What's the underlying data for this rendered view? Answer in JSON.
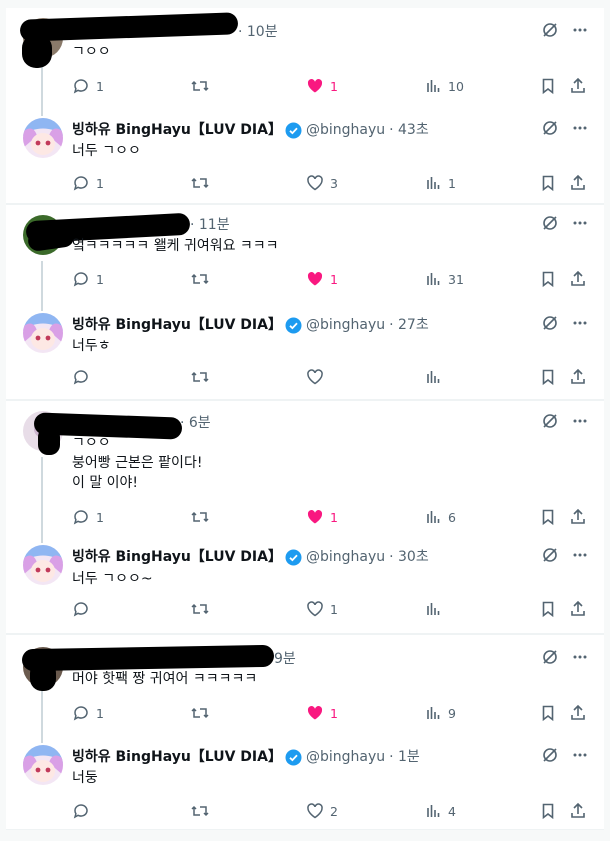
{
  "threads": [
    {
      "reply": {
        "time_label": "· 10분",
        "text": "ㄱㅇㅇ",
        "stats": {
          "replies": "1",
          "retweets": "",
          "likes": "1",
          "views": "10"
        },
        "liked": true
      },
      "answer": {
        "name": "빙하유 BingHayu【LUV DIA】",
        "handle": "@binghayu",
        "time_label": "· 43초",
        "text": "너두 ㄱㅇㅇ",
        "stats": {
          "replies": "1",
          "retweets": "",
          "likes": "3",
          "views": "1"
        },
        "liked": false
      }
    },
    {
      "reply": {
        "time_label": "· 11분",
        "text": "엌ㅋㅋㅋㅋㅋ 왤케 귀여워요 ㅋㅋㅋ",
        "stats": {
          "replies": "1",
          "retweets": "",
          "likes": "1",
          "views": "31"
        },
        "liked": true
      },
      "answer": {
        "name": "빙하유 BingHayu【LUV DIA】",
        "handle": "@binghayu",
        "time_label": "· 27초",
        "text": "너두ㅎ",
        "stats": {
          "replies": "",
          "retweets": "",
          "likes": "",
          "views": ""
        },
        "liked": false
      }
    },
    {
      "reply": {
        "time_label": "· 6분",
        "text": "ㄱㅇㅇ\n붕어빵 근본은 팥이다!\n이 말 이야!",
        "stats": {
          "replies": "1",
          "retweets": "",
          "likes": "1",
          "views": "6"
        },
        "liked": true
      },
      "answer": {
        "name": "빙하유 BingHayu【LUV DIA】",
        "handle": "@binghayu",
        "time_label": "· 30초",
        "text": "너두 ㄱㅇㅇ~",
        "stats": {
          "replies": "",
          "retweets": "",
          "likes": "1",
          "views": ""
        },
        "liked": false
      }
    },
    {
      "reply": {
        "time_label": "9분",
        "text": "머야 핫팩 짱 귀여어 ㅋㅋㅋㅋㅋ",
        "stats": {
          "replies": "1",
          "retweets": "",
          "likes": "1",
          "views": "9"
        },
        "liked": true
      },
      "answer": {
        "name": "빙하유 BingHayu【LUV DIA】",
        "handle": "@binghayu",
        "time_label": "· 1분",
        "text": "너둥",
        "stats": {
          "replies": "",
          "retweets": "",
          "likes": "2",
          "views": "4"
        },
        "liked": false
      }
    }
  ],
  "icons": {
    "reply": "speech-bubble-icon",
    "retweet": "retweet-arrows-icon",
    "like": "heart-icon",
    "views": "bar-chart-icon",
    "bookmark": "bookmark-icon",
    "share": "share-upload-icon",
    "grok": "grok-slash-circle-icon",
    "more": "more-dots-icon",
    "verified": "verified-badge-icon"
  },
  "colors": {
    "like_active": "#f91880",
    "muted": "#536471",
    "verified": "#1d9bf0",
    "thread_line": "#cfd9de",
    "redaction": "#000000"
  }
}
